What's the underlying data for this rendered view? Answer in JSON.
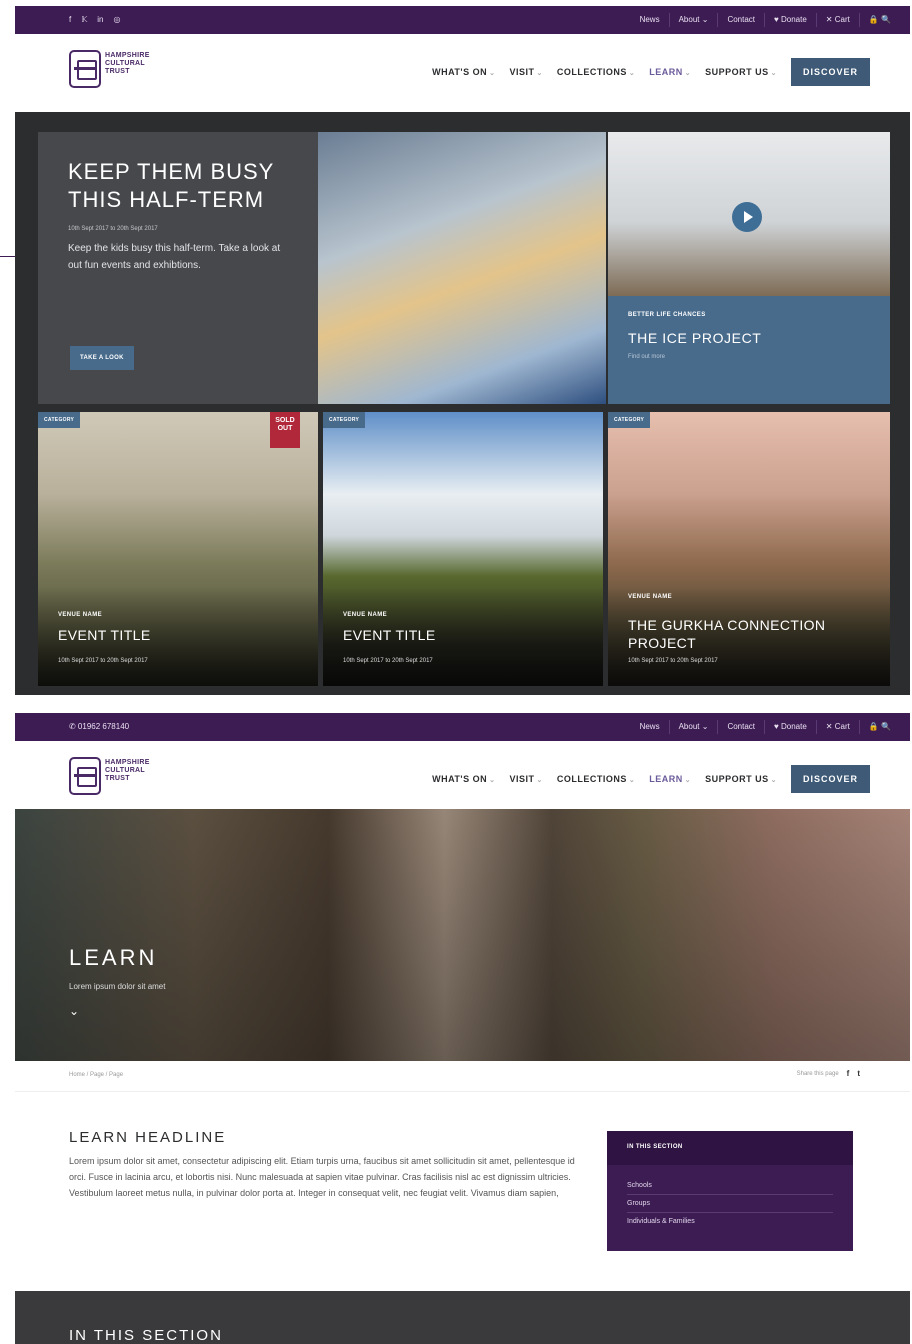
{
  "top1": {
    "social": [
      "f",
      "𝕂",
      "in",
      "◎"
    ],
    "links": [
      "News",
      "About ⌄",
      "Contact",
      "♥ Donate",
      "✕ Cart",
      "🔒 🔍"
    ]
  },
  "top2": {
    "phone": "✆ 01962 678140",
    "links": [
      "News",
      "About ⌄",
      "Contact",
      "♥ Donate",
      "✕ Cart",
      "🔒 🔍"
    ]
  },
  "logo": {
    "line1": "HAMPSHIRE",
    "line2": "CULTURAL",
    "line3": "TRUST"
  },
  "nav": {
    "items": [
      "WHAT'S ON",
      "VISIT",
      "COLLECTIONS",
      "LEARN",
      "SUPPORT US"
    ],
    "discover": "DISCOVER"
  },
  "featured": {
    "heading": "KEEP THEM BUSY THIS HALF-TERM",
    "date": "10th Sept 2017 to 20th Sept 2017",
    "desc": "Keep the kids busy this half-term. Take a look at out fun events and exhibtions.",
    "button": "TAKE A LOOK"
  },
  "video": {
    "category": "BETTER LIFE CHANCES",
    "title": "THE ICE PROJECT",
    "more": "Find out more"
  },
  "cards": [
    {
      "tag": "CATEGORY",
      "sold": "SOLD OUT",
      "venue": "VENUE NAME",
      "title": "EVENT TITLE",
      "date": "10th Sept 2017 to 20th Sept 2017"
    },
    {
      "tag": "CATEGORY",
      "venue": "VENUE NAME",
      "title": "EVENT TITLE",
      "date": "10th Sept 2017 to 20th Sept 2017"
    },
    {
      "tag": "CATEGORY",
      "venue": "VENUE NAME",
      "title": "THE GURKHA CONNECTION PROJECT",
      "date": "10th Sept 2017 to 20th Sept 2017"
    }
  ],
  "learn": {
    "hero_title": "LEARN",
    "hero_sub": "Lorem ipsum dolor sit amet",
    "breadcrumb": "Home / Page / Page",
    "share": "Share this page",
    "headline": "LEARN HEADLINE",
    "body": "Lorem ipsum dolor sit amet, consectetur adipiscing elit. Etiam turpis urna, faucibus sit amet sollicitudin sit amet, pellentesque id orci. Fusce in lacinia arcu, et lobortis nisi. Nunc malesuada at sapien vitae pulvinar. Cras facilisis nisl ac est dignissim ultricies. Vestibulum laoreet metus nulla, in pulvinar dolor porta at. Integer in consequat velit, nec feugiat velit. Vivamus diam sapien,",
    "sidebar_title": "IN THIS SECTION",
    "sidebar_items": [
      "Schools",
      "Groups",
      "Individuals & Families"
    ],
    "footer_title": "IN THIS SECTION"
  }
}
